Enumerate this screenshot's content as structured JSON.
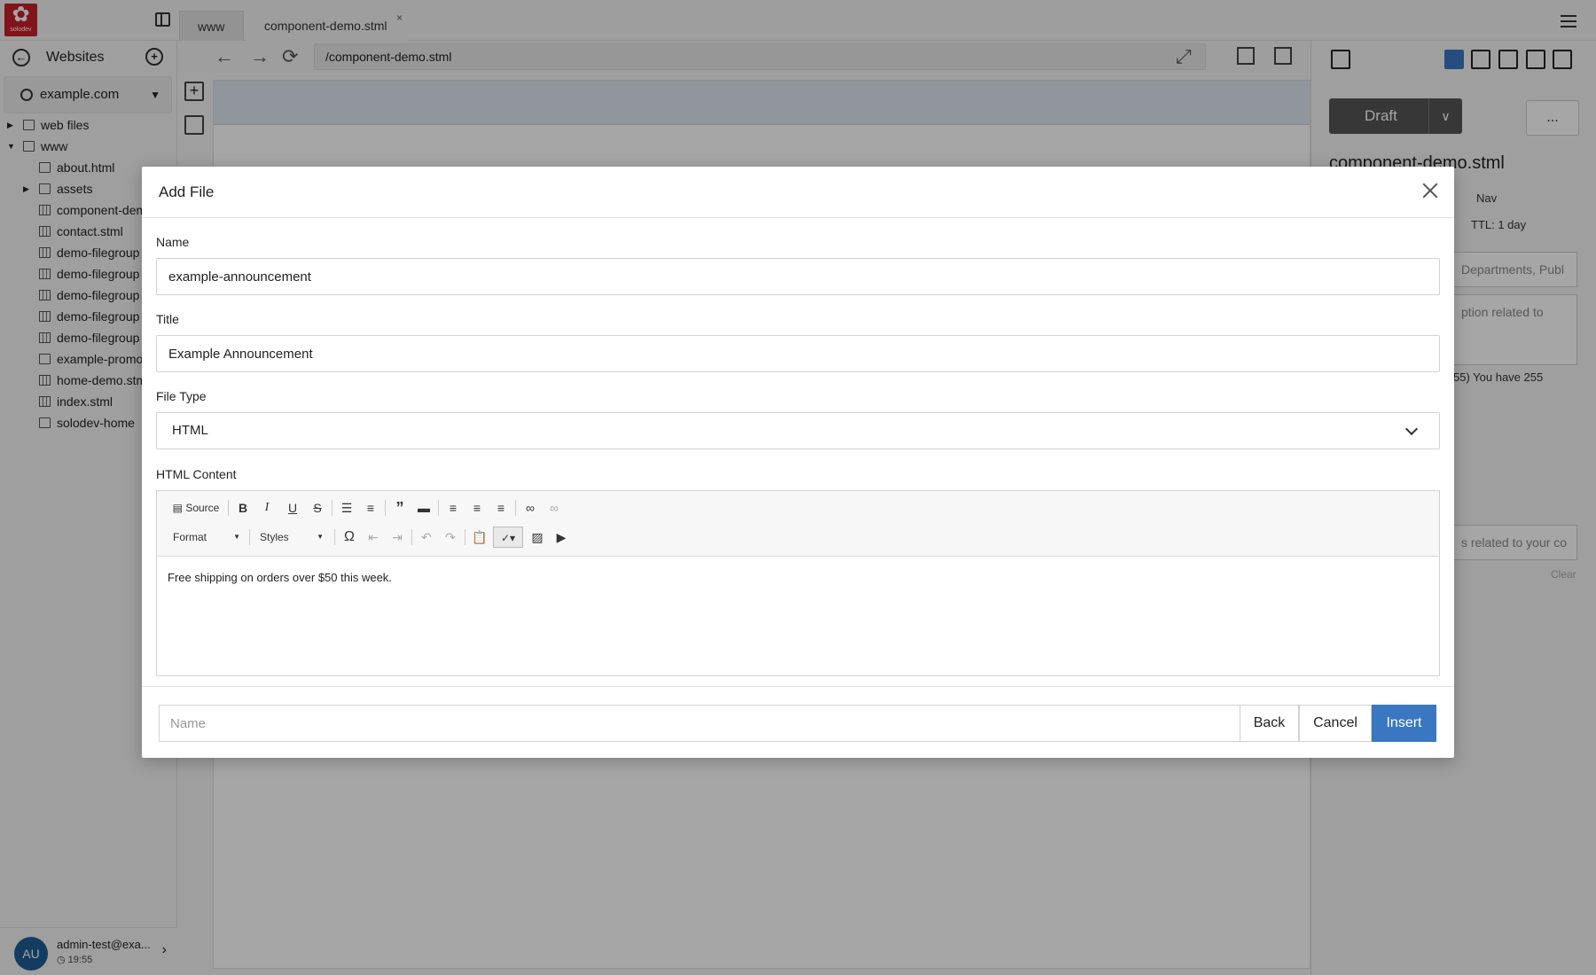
{
  "app": {
    "logo_text": "solodev"
  },
  "tabs": [
    {
      "label": "www"
    },
    {
      "label": "component-demo.stml"
    }
  ],
  "sidebar": {
    "title": "Websites",
    "site": "example.com",
    "tree": [
      {
        "label": "web files",
        "type": "folder",
        "level": 0,
        "expanded": false
      },
      {
        "label": "www",
        "type": "folder",
        "level": 0,
        "expanded": true
      },
      {
        "label": "about.html",
        "type": "html",
        "level": 1
      },
      {
        "label": "assets",
        "type": "folder",
        "level": 1,
        "expanded": false
      },
      {
        "label": "component-demo.stml",
        "type": "page",
        "level": 1
      },
      {
        "label": "contact.stml",
        "type": "page",
        "level": 1
      },
      {
        "label": "demo-filegroup",
        "type": "page",
        "level": 1
      },
      {
        "label": "demo-filegroup",
        "type": "page",
        "level": 1
      },
      {
        "label": "demo-filegroup",
        "type": "page",
        "level": 1
      },
      {
        "label": "demo-filegroup",
        "type": "page",
        "level": 1
      },
      {
        "label": "demo-filegroup",
        "type": "page",
        "level": 1
      },
      {
        "label": "example-promo",
        "type": "html",
        "level": 1
      },
      {
        "label": "home-demo.stml",
        "type": "page",
        "level": 1
      },
      {
        "label": "index.stml",
        "type": "page",
        "level": 1
      },
      {
        "label": "solodev-home",
        "type": "link",
        "level": 1
      }
    ],
    "user": {
      "initials": "AU",
      "name": "admin-test@exa...",
      "time": "19:55"
    }
  },
  "browser": {
    "url": "/component-demo.stml"
  },
  "right_panel": {
    "status": "Draft",
    "more": "...",
    "file_title": "component-demo.stml",
    "nav_label": "Nav",
    "ttl": "TTL: 1 day",
    "categories_placeholder": "Departments, Publ",
    "description_placeholder": "ption related to",
    "char_count": "55) You have 255",
    "keywords_placeholder": "s related to your co",
    "clear": "Clear"
  },
  "modal": {
    "title": "Add File",
    "name_label": "Name",
    "name_value": "example-announcement",
    "title_label": "Title",
    "title_value": "Example Announcement",
    "filetype_label": "File Type",
    "filetype_value": "HTML",
    "content_label": "HTML Content",
    "toolbar": {
      "source": "Source",
      "format": "Format",
      "styles": "Styles"
    },
    "content_text": "Free shipping on orders over $50 this week.",
    "footer_placeholder": "Name",
    "back": "Back",
    "cancel": "Cancel",
    "insert": "Insert"
  },
  "colors": {
    "primary": "#3a77c1",
    "logo": "#c8202a",
    "draft": "#555555"
  }
}
